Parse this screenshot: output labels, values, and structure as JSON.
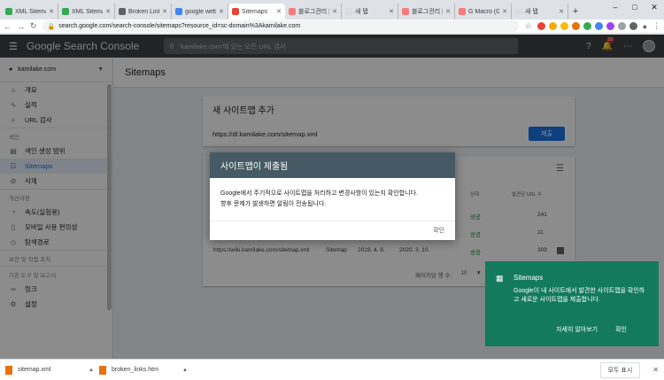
{
  "browser": {
    "tabs": [
      {
        "label": "XML Sitemap",
        "color": "#34a853"
      },
      {
        "label": "XML Sitemap",
        "color": "#34a853"
      },
      {
        "label": "Broken Links",
        "color": "#5f6368"
      },
      {
        "label": "google webm",
        "color": "#4285f4"
      },
      {
        "label": "Sitemaps",
        "color": "#ea4335"
      },
      {
        "label": "블로그관리 |",
        "color": "#fa7a7a"
      },
      {
        "label": "새 탭",
        "color": "#dadce0"
      },
      {
        "label": "블로그관리 |",
        "color": "#fa7a7a"
      },
      {
        "label": "G Macro (Gif)",
        "color": "#fa7a7a"
      },
      {
        "label": "새 탭",
        "color": "#dadce0"
      }
    ],
    "active_tab_index": 4,
    "url": "search.google.com/search-console/sitemaps?resource_id=sc-domain%3Akamilake.com"
  },
  "gsc": {
    "brand": "Google Search Console",
    "search_placeholder": "'kamilake.com'에 있는 모든 URL 검사",
    "notif_count": "10"
  },
  "sidebar": {
    "property": "kamilake.com",
    "items_top": [
      {
        "label": "개요",
        "icon": "home-icon"
      },
      {
        "label": "실적",
        "icon": "trend-icon"
      },
      {
        "label": "URL 검사",
        "icon": "search-icon"
      }
    ],
    "section_index": "색인",
    "items_index": [
      {
        "label": "색인 생성 범위",
        "icon": "coverage-icon"
      },
      {
        "label": "Sitemaps",
        "icon": "sitemap-icon",
        "active": true
      },
      {
        "label": "삭제",
        "icon": "remove-icon"
      }
    ],
    "section_enh": "개선사항",
    "items_enh": [
      {
        "label": "속도(실험용)",
        "icon": "speed-icon"
      },
      {
        "label": "모바일 사용 편의성",
        "icon": "mobile-icon"
      },
      {
        "label": "탐색경로",
        "icon": "breadcrumb-icon"
      }
    ],
    "section_security": "보안 및 직접 조치",
    "section_legacy": "기존 도구 및 보고서",
    "items_bottom": [
      {
        "label": "링크",
        "icon": "links-icon"
      },
      {
        "label": "설정",
        "icon": "settings-icon"
      }
    ]
  },
  "main": {
    "title": "Sitemaps",
    "add_title": "새 사이트맵 추가",
    "add_value": "https://dl.kamilake.com/sitemap.xml",
    "submit_label": "제출",
    "col_status": "상태",
    "col_urls": "발견된 URL 수",
    "rows": [
      {
        "url": "",
        "type": "",
        "submitted": "",
        "read": "",
        "status": "성공",
        "count": "241"
      },
      {
        "url": "",
        "type": "",
        "submitted": "",
        "read": "",
        "status": "성공",
        "count": "11"
      },
      {
        "url": "https://wiki.kamilake.com/sitemap.xml",
        "type": "Sitemap",
        "submitted": "2019. 4. 8.",
        "read": "2020. 3. 10.",
        "status": "성공",
        "count": "309"
      }
    ],
    "rows_per_page_label": "페이지당 행 수:",
    "rows_per_page": "10"
  },
  "dialog": {
    "title": "사이트맵이 제출됨",
    "body1": "Google에서 주기적으로 사이트맵을 처리하고 변경사항이 있는지 확인합니다.",
    "body2": "향후 문제가 발생하면 알림이 전송됩니다.",
    "confirm": "확인"
  },
  "toast": {
    "title": "Sitemaps",
    "body": "Google이 내 사이트에서 발견한 사이트맵을 확인하고 새로운 사이트맵을 제출합니다.",
    "learn": "자세히 알아보기",
    "ok": "확인"
  },
  "downloads": {
    "items": [
      "sitemap.xml",
      "broken_links.htm"
    ],
    "show_all": "모두 표시"
  }
}
